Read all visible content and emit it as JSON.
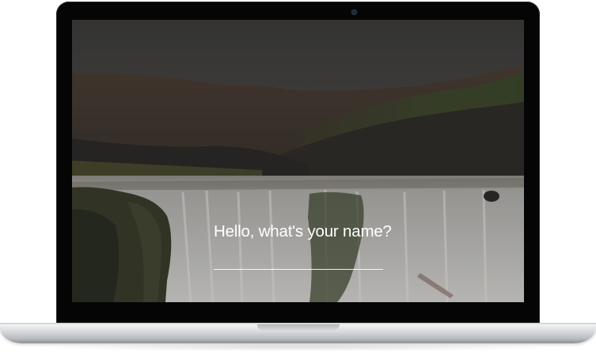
{
  "prompt": {
    "question": "Hello, what's your name?",
    "input_value": "",
    "input_placeholder": ""
  },
  "colors": {
    "text": "#ffffff",
    "underline": "#ffffff",
    "bezel": "#050505",
    "chassis": "#d9dbde"
  },
  "icons": {
    "camera": "camera-icon"
  }
}
